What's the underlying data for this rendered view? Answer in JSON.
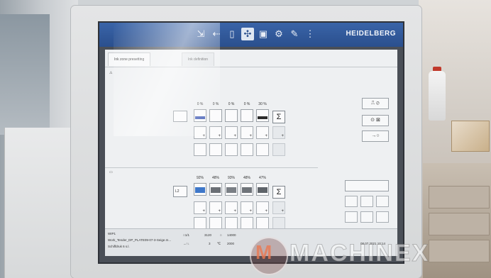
{
  "app": {
    "brand": "HEIDELBERG",
    "tabs": [
      "Ink zone presetting",
      "Ink definition"
    ]
  },
  "toolbar": {
    "icons": [
      "arrow-in-icon",
      "arrow-left-icon",
      "page-icon",
      "ink-icon",
      "unit-icon",
      "settings-icon",
      "pen-icon",
      "more-icon"
    ]
  },
  "upper_unit": {
    "label": "",
    "percentages": [
      "",
      "0 %",
      "0 %",
      "0 %",
      "0 %",
      "30 %"
    ]
  },
  "lower_unit": {
    "label": "L2",
    "percentages": [
      "92%",
      "48%",
      "93%",
      "48%",
      "47%"
    ]
  },
  "sidebar": {
    "buttons": [
      "",
      "",
      "",
      "",
      "→○"
    ]
  },
  "statusbar": {
    "line1": "WIP1",
    "line2": "Work_Tender_DP_PLATE09-07-3-Seige.m...",
    "line3": "Schiffdruk 6 s.l.",
    "speed_label": "○1/1",
    "speed_value": "3120",
    "counter_label": "○",
    "counter_value": "14000",
    "press_label": "→↑↓",
    "press_value": "3",
    "temp_label": "℃",
    "temp_value": "2000",
    "date": "08.07.2021 10:14"
  },
  "watermark": {
    "text": "MACHINEX"
  },
  "colors": {
    "topbar": "#2a4f8d",
    "screen_bg": "#eef0f2",
    "accent_yellow": "#e4d66a"
  }
}
